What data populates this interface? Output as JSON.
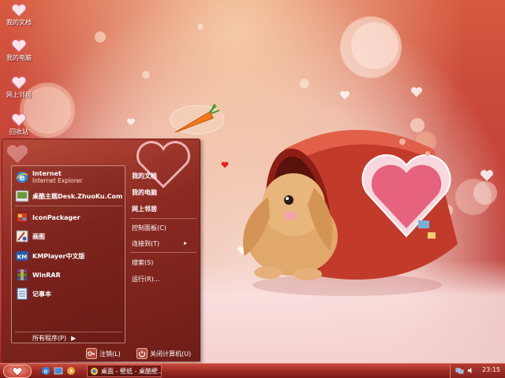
{
  "desktop": {
    "icons": [
      {
        "label": "我的文档",
        "icon": "heart-icon"
      },
      {
        "label": "我的电脑",
        "icon": "heart-icon"
      },
      {
        "label": "网上邻居",
        "icon": "heart-icon"
      },
      {
        "label": "回收站",
        "icon": "heart-icon"
      }
    ]
  },
  "start_menu": {
    "pinned": [
      {
        "title": "Internet",
        "subtitle": "Internet Explorer",
        "icon": "internet-explorer-icon"
      },
      {
        "title": "桌酷主题Desk.ZhuoKu.Com",
        "icon": "theme-icon"
      }
    ],
    "recent": [
      {
        "title": "IconPackager",
        "icon": "iconpackager-icon"
      },
      {
        "title": "画图",
        "icon": "paint-icon"
      },
      {
        "title": "KMPlayer中文版",
        "icon": "kmplayer-icon"
      },
      {
        "title": "WinRAR",
        "icon": "winrar-icon"
      },
      {
        "title": "记事本",
        "icon": "notepad-icon"
      }
    ],
    "all_programs": "所有程序(P)",
    "right": {
      "my_documents": "我的文档",
      "my_computer": "我的电脑",
      "network": "网上邻居",
      "control_panel": "控制面板(C)",
      "connect_to": "连接到(T)",
      "search": "搜索(S)",
      "run": "运行(R)..."
    },
    "logoff": "注销(L)",
    "shutdown": "关闭计算机(U)"
  },
  "taskbar": {
    "task_label": "桌面 - 壁纸 - 桌酷壁...",
    "clock": "23:15"
  },
  "colors": {
    "accent": "#c24038",
    "menu_bg": "#8c2a22"
  }
}
